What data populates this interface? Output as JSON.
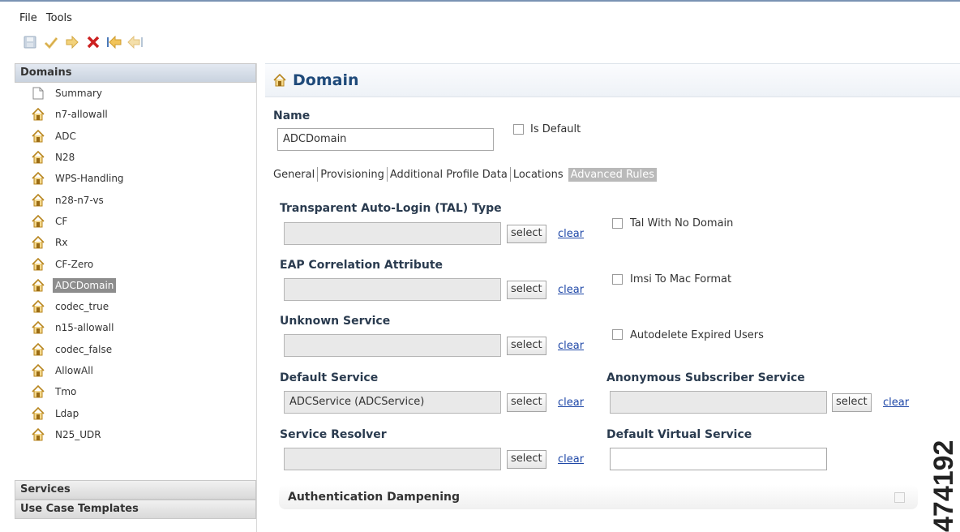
{
  "menu": {
    "items": [
      "File",
      "Tools"
    ]
  },
  "toolbar": {
    "buttons": [
      "save-icon",
      "check-icon",
      "forward-icon",
      "delete-icon",
      "import-icon",
      "export-icon"
    ],
    "colors": {
      "delete": "#cc2020",
      "arrows": "#e3b44a",
      "disabled": "#b8c6d6"
    }
  },
  "sidebar": {
    "domains_header": "Domains",
    "items": [
      {
        "label": "Summary",
        "icon": "document-icon"
      },
      {
        "label": "n7-allowall",
        "icon": "house-icon"
      },
      {
        "label": "ADC",
        "icon": "house-icon"
      },
      {
        "label": "N28",
        "icon": "house-icon"
      },
      {
        "label": "WPS-Handling",
        "icon": "house-icon"
      },
      {
        "label": "n28-n7-vs",
        "icon": "house-icon"
      },
      {
        "label": "CF",
        "icon": "house-icon"
      },
      {
        "label": "Rx",
        "icon": "house-icon"
      },
      {
        "label": "CF-Zero",
        "icon": "house-icon"
      },
      {
        "label": "ADCDomain",
        "icon": "house-icon",
        "selected": true
      },
      {
        "label": "codec_true",
        "icon": "house-icon"
      },
      {
        "label": "n15-allowall",
        "icon": "house-icon"
      },
      {
        "label": "codec_false",
        "icon": "house-icon"
      },
      {
        "label": "AllowAll",
        "icon": "house-icon"
      },
      {
        "label": "Tmo",
        "icon": "house-icon"
      },
      {
        "label": "Ldap",
        "icon": "house-icon"
      },
      {
        "label": "N25_UDR",
        "icon": "house-icon"
      }
    ],
    "services_header": "Services",
    "templates_header": "Use Case Templates"
  },
  "main": {
    "title": "Domain",
    "name_label": "Name",
    "name_value": "ADCDomain",
    "is_default_label": "Is Default",
    "is_default_checked": false,
    "tabs": [
      "General",
      "Provisioning",
      "Additional Profile Data",
      "Locations",
      "Advanced Rules"
    ],
    "active_tab": "Advanced Rules",
    "select_label": "select",
    "clear_label": "clear",
    "fields": {
      "tal_type": {
        "label": "Transparent Auto-Login (TAL) Type",
        "value": ""
      },
      "eap": {
        "label": "EAP Correlation Attribute",
        "value": ""
      },
      "unknown_service": {
        "label": "Unknown Service",
        "value": ""
      },
      "default_service": {
        "label": "Default Service",
        "value": "ADCService (ADCService)"
      },
      "service_resolver": {
        "label": "Service Resolver",
        "value": ""
      },
      "anonymous_service": {
        "label": "Anonymous Subscriber Service",
        "value": ""
      },
      "default_virtual_service": {
        "label": "Default Virtual Service",
        "value": ""
      }
    },
    "checkboxes": {
      "tal_no_domain": {
        "label": "Tal With No Domain",
        "checked": false
      },
      "imsi_mac": {
        "label": "Imsi To Mac Format",
        "checked": false
      },
      "autodelete": {
        "label": "Autodelete Expired Users",
        "checked": false
      }
    },
    "auth_dampening": "Authentication Dampening"
  },
  "figure_id": "474192",
  "colors": {
    "title": "#1f4a7a",
    "link": "#1e47a7",
    "selected_item": "#8d8d8d",
    "active_tab": "#b9b9b9"
  }
}
